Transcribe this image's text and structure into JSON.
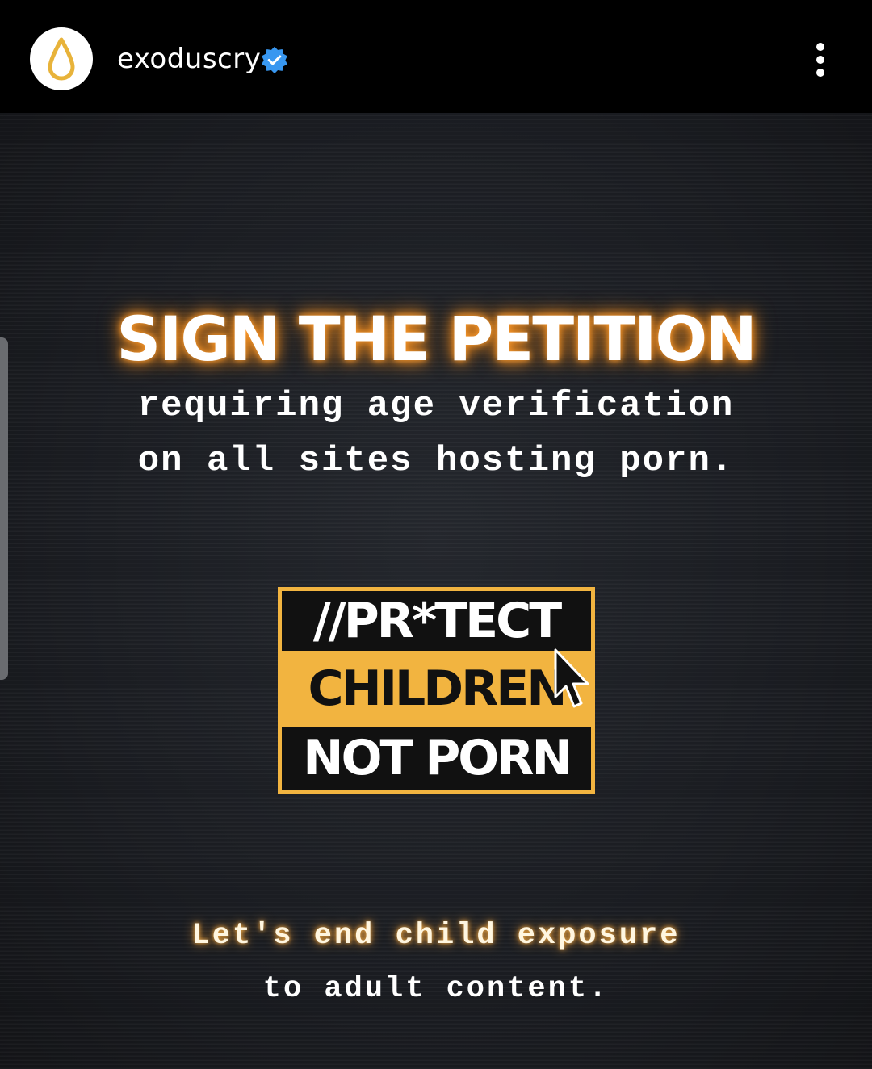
{
  "header": {
    "username": "exoduscry",
    "avatar_icon": "droplet-icon",
    "verified_icon": "verified-badge-icon",
    "menu_icon": "more-vertical-icon"
  },
  "post": {
    "headline": "SIGN THE PETITION",
    "subline_1": "requiring age verification",
    "subline_2": "on all sites hosting porn.",
    "logo": {
      "row_1": "//PR*TECT",
      "row_2": "CHILDREN",
      "row_3": "NOT PORN"
    },
    "tagline_1": "Let's end child exposure",
    "tagline_2": "to adult content."
  },
  "colors": {
    "accent_gold": "#f2b440",
    "verified_blue": "#3897f0",
    "glow_orange": "#f08a1c",
    "background": "#1a1c20"
  }
}
